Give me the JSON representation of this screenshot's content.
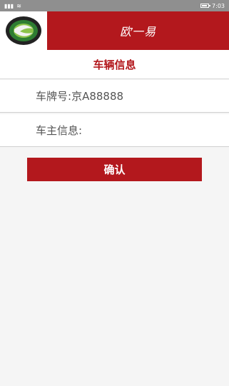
{
  "status_bar": {
    "left_icons": "📶",
    "time": "7:03"
  },
  "header": {
    "title": "欧一易"
  },
  "section": {
    "title": "车辆信息"
  },
  "fields": {
    "plate_label": "车牌号:",
    "plate_value": "京A88888",
    "owner_label": "车主信息:"
  },
  "actions": {
    "confirm_label": "确认"
  }
}
